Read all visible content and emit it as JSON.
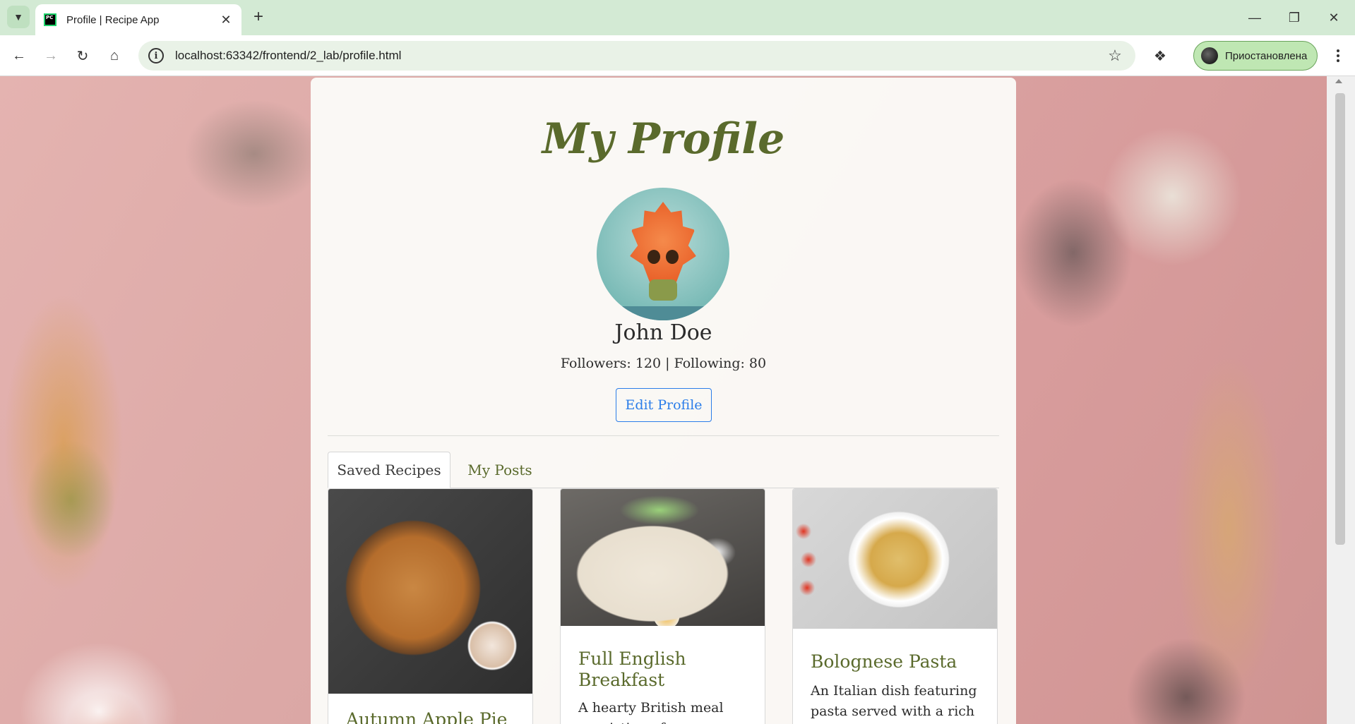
{
  "browser": {
    "tab_title": "Profile | Recipe App",
    "url": "localhost:63342/frontend/2_lab/profile.html",
    "profile_chip_label": "Приостановлена",
    "favicon_text": "PC"
  },
  "page": {
    "title": "My Profile",
    "user_name": "John Doe",
    "stats": "Followers: 120 | Following: 80",
    "edit_button": "Edit Profile",
    "tabs": [
      {
        "label": "Saved Recipes",
        "active": true
      },
      {
        "label": "My Posts",
        "active": false
      }
    ],
    "recipes": [
      {
        "title": "Autumn Apple Pie",
        "description": ""
      },
      {
        "title": "Full English Breakfast",
        "description": "A hearty British meal consisting of sausages,"
      },
      {
        "title": "Bolognese Pasta",
        "description": "An Italian dish featuring pasta served with a rich sauce made of"
      }
    ]
  },
  "colors": {
    "title_green": "#5a6a2c",
    "link_blue": "#2b7de9",
    "tabbar_bg": "#d3ead4"
  }
}
